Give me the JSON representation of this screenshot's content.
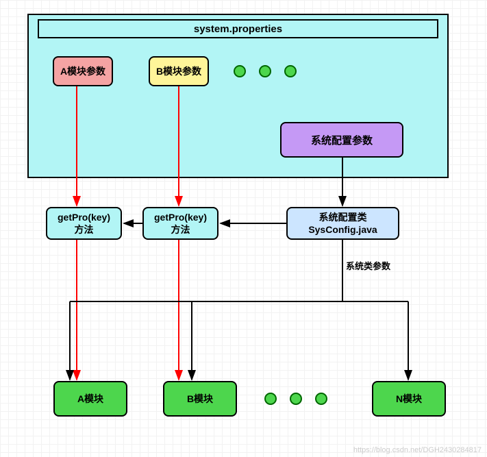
{
  "container": {
    "title": "system.properties",
    "module_a_params": "A模块参数",
    "module_b_params": "B模块参数",
    "sys_config_params": "系统配置参数"
  },
  "methods": {
    "get_pro_a": "getPro(key)\n方法",
    "get_pro_b": "getPro(key)\n方法",
    "sys_config_class": "系统配置类\nSysConfig.java"
  },
  "labels": {
    "sys_class_params": "系统类参数"
  },
  "modules": {
    "a": "A模块",
    "b": "B模块",
    "n": "N模块"
  },
  "watermark": "https://blog.csdn.net/DGH2430284817"
}
